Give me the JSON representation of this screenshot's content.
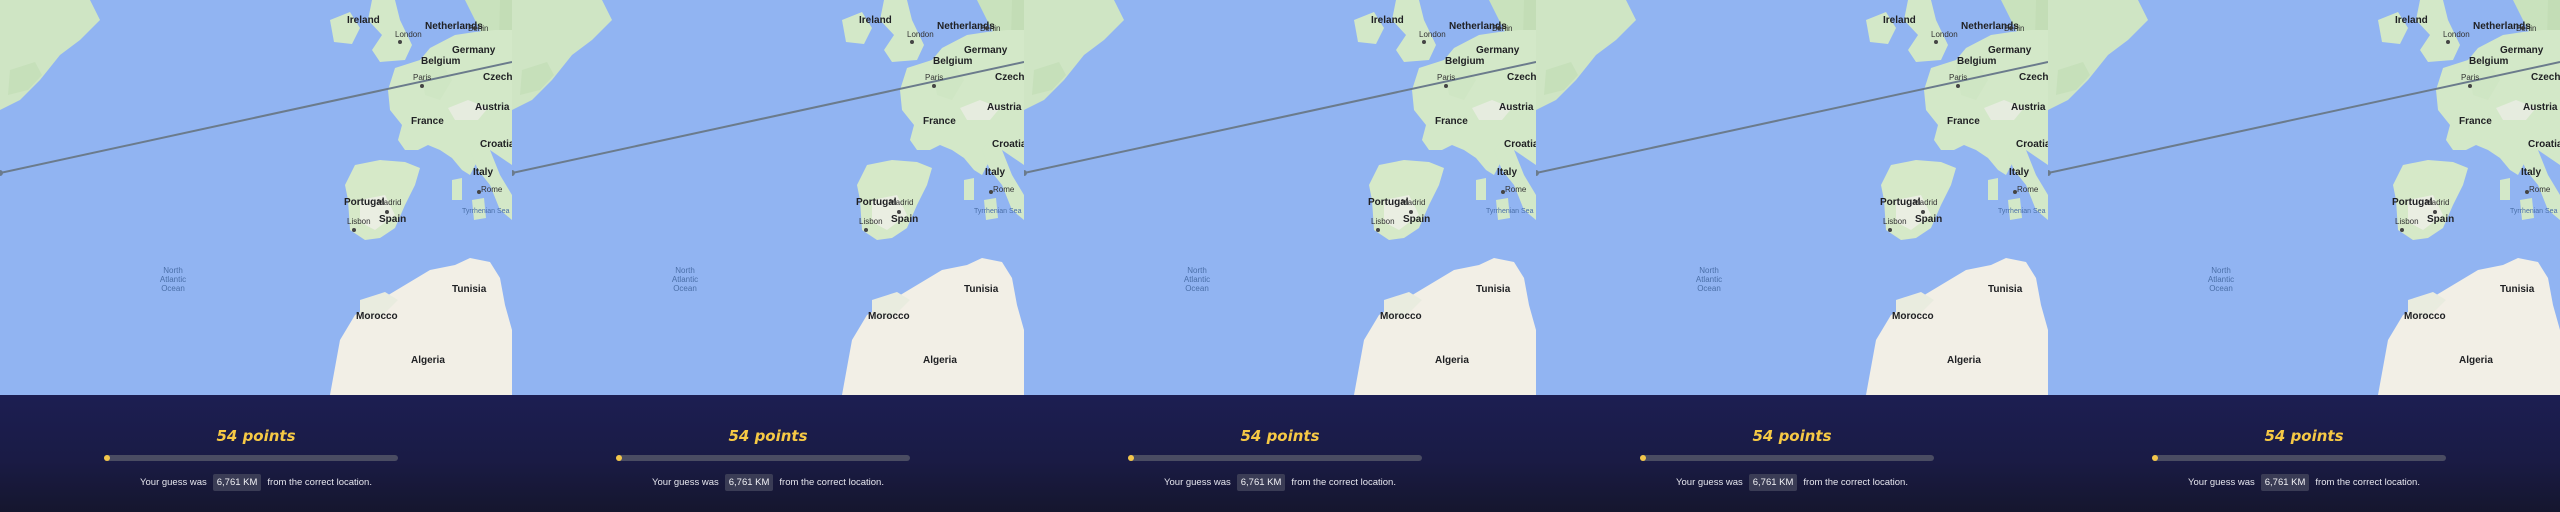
{
  "panels": [
    {
      "id": "p1"
    },
    {
      "id": "p2"
    },
    {
      "id": "p3"
    },
    {
      "id": "p4"
    },
    {
      "id": "p5"
    }
  ],
  "map": {
    "countries": [
      "Ireland",
      "Netherlands",
      "Germany",
      "Belgium",
      "Czechia",
      "France",
      "Austria",
      "Croatia",
      "Italy",
      "Portugal",
      "Spain",
      "Morocco",
      "Algeria",
      "Tunisia"
    ],
    "cities": [
      "London",
      "Berlin",
      "Paris",
      "Madrid",
      "Lisbon",
      "Rome"
    ],
    "ocean": "North Atlantic Ocean",
    "sea": "Tyrrhenian Sea",
    "water_colors": {
      "sea": "#91b4f2",
      "land": "#d3e8c8",
      "desert": "#f2efe6",
      "route": "#6b7b8c"
    }
  },
  "result": {
    "points_label": "54 points",
    "progress": 0.02,
    "guess_prefix": "Your guess was",
    "distance": "6,761 KM",
    "guess_suffix": "from the correct location."
  }
}
